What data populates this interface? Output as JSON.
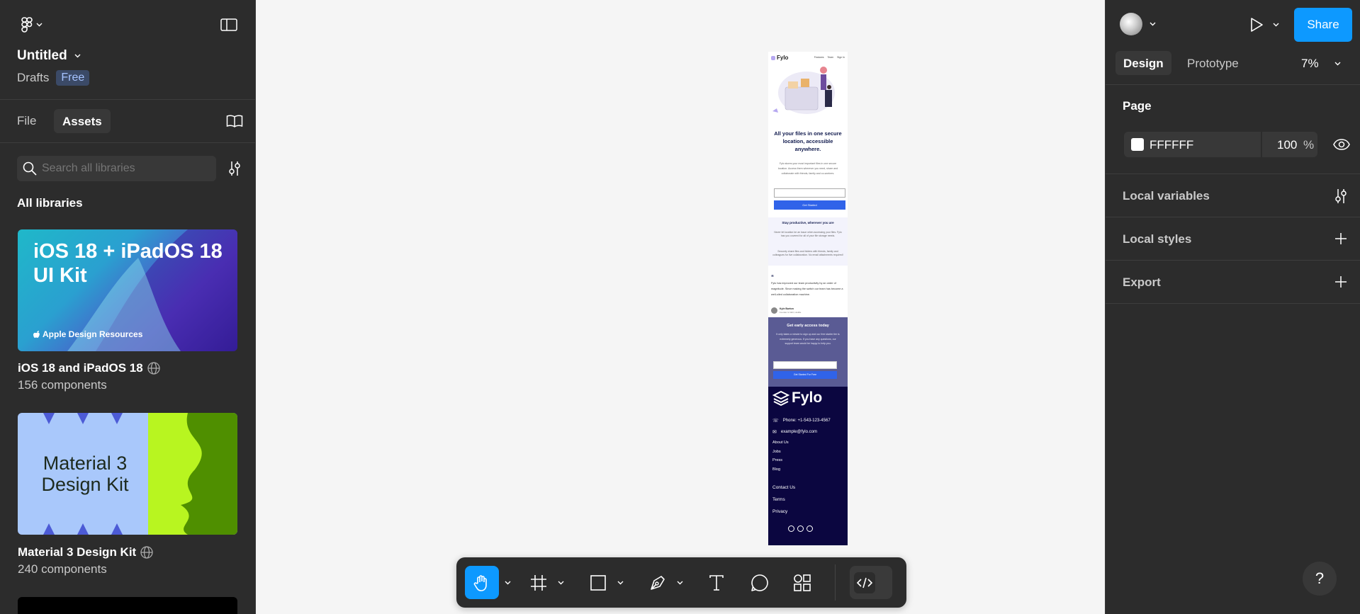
{
  "left_panel": {
    "file_title": "Untitled",
    "location": "Drafts",
    "plan_badge": "Free",
    "tabs": [
      {
        "label": "File"
      },
      {
        "label": "Assets"
      }
    ],
    "search_placeholder": "Search all libraries",
    "section_title": "All libraries",
    "libraries": [
      {
        "thumb_title": "iOS 18 + iPadOS 18 UI Kit",
        "thumb_sub": "Apple Design Resources",
        "name": "iOS 18 and iPadOS 18",
        "count": "156 components"
      },
      {
        "thumb_title": "Material 3 Design Kit",
        "name": "Material 3 Design Kit",
        "count": "240 components"
      }
    ]
  },
  "right_panel": {
    "tabs": [
      {
        "label": "Design"
      },
      {
        "label": "Prototype"
      }
    ],
    "zoom": "7%",
    "share_label": "Share",
    "page_section": "Page",
    "page_color": "FFFFFF",
    "page_opacity": "100",
    "opacity_unit": "%",
    "sections": [
      {
        "label": "Local variables"
      },
      {
        "label": "Local styles"
      },
      {
        "label": "Export"
      }
    ],
    "help_label": "?"
  },
  "design": {
    "brand": "Fylo",
    "nav": [
      "Features",
      "Team",
      "Sign In"
    ],
    "headline": "All your files in one secure location, accessible anywhere.",
    "intro": "Fylo stores your most important files in one secure location. Access them wherever you need, share and collaborate with friends, family and co-workers.",
    "cta": "Get Started",
    "productive_title": "Stay productive, wherever you are",
    "productive_p1": "Never let location be an issue when accessing your files. Fylo has you covered for all of your file storage needs.",
    "productive_p2": "Securely share files and folders with friends, family and colleagues for live collaboration. No email attachments required!",
    "quote": "Fylo has improved our team productivity by an order of magnitude. Since making the switch our team has become a well-oiled collaboration machine.",
    "author": "Kyle Burton",
    "author_role": "Founder & CEO, Huddle",
    "early_title": "Get early access today",
    "early_text": "It only takes a minute to sign up and our free starter tier is extremely generous. If you have any questions, our support team would be happy to help you.",
    "early_cta": "Get Started For Free",
    "footer_brand": "Fylo",
    "phone": "Phone: +1-543-123-4567",
    "email": "example@fylo.com",
    "links_a": [
      "About Us",
      "Jobs",
      "Press",
      "Blog"
    ],
    "links_b": [
      "Contact Us",
      "Terms",
      "Privacy"
    ]
  }
}
